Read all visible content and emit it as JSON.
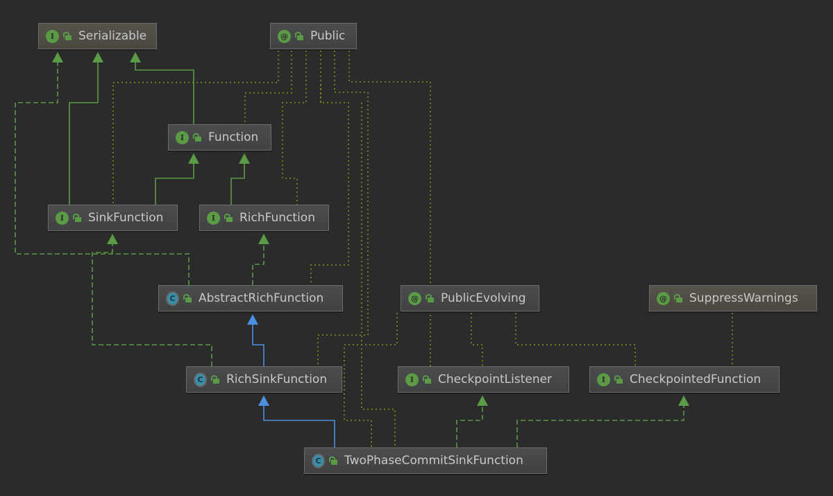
{
  "diagram": {
    "nodes": [
      {
        "id": "serializable",
        "label": "Serializable",
        "kind": "interface",
        "badge": "I"
      },
      {
        "id": "public",
        "label": "Public",
        "kind": "annotation",
        "badge": "@"
      },
      {
        "id": "function",
        "label": "Function",
        "kind": "interface",
        "badge": "I"
      },
      {
        "id": "sinkfunction",
        "label": "SinkFunction",
        "kind": "interface",
        "badge": "I"
      },
      {
        "id": "richfunction",
        "label": "RichFunction",
        "kind": "interface",
        "badge": "I"
      },
      {
        "id": "abstractrichfunction",
        "label": "AbstractRichFunction",
        "kind": "abstract-class",
        "badge": "C"
      },
      {
        "id": "publicevolving",
        "label": "PublicEvolving",
        "kind": "annotation",
        "badge": "@"
      },
      {
        "id": "suppresswarnings",
        "label": "SuppressWarnings",
        "kind": "annotation",
        "badge": "@"
      },
      {
        "id": "richsinkfunction",
        "label": "RichSinkFunction",
        "kind": "abstract-class",
        "badge": "C"
      },
      {
        "id": "checkpointlistener",
        "label": "CheckpointListener",
        "kind": "interface",
        "badge": "I"
      },
      {
        "id": "checkpointedfunction",
        "label": "CheckpointedFunction",
        "kind": "interface",
        "badge": "I"
      },
      {
        "id": "twophasecommitsinkfunction",
        "label": "TwoPhaseCommitSinkFunction",
        "kind": "abstract-class",
        "badge": "C"
      }
    ],
    "edges": [
      {
        "from": "function",
        "to": "serializable",
        "type": "extends-interface"
      },
      {
        "from": "sinkfunction",
        "to": "serializable",
        "type": "extends-interface"
      },
      {
        "from": "sinkfunction",
        "to": "function",
        "type": "extends-interface"
      },
      {
        "from": "richfunction",
        "to": "function",
        "type": "extends-interface"
      },
      {
        "from": "abstractrichfunction",
        "to": "serializable",
        "type": "implements"
      },
      {
        "from": "abstractrichfunction",
        "to": "richfunction",
        "type": "implements"
      },
      {
        "from": "richsinkfunction",
        "to": "sinkfunction",
        "type": "implements"
      },
      {
        "from": "richsinkfunction",
        "to": "abstractrichfunction",
        "type": "extends-class"
      },
      {
        "from": "twophasecommitsinkfunction",
        "to": "richsinkfunction",
        "type": "extends-class"
      },
      {
        "from": "twophasecommitsinkfunction",
        "to": "checkpointlistener",
        "type": "implements"
      },
      {
        "from": "twophasecommitsinkfunction",
        "to": "checkpointedfunction",
        "type": "implements"
      },
      {
        "from": "public",
        "to": "sinkfunction",
        "type": "annotates"
      },
      {
        "from": "public",
        "to": "function",
        "type": "annotates"
      },
      {
        "from": "public",
        "to": "richfunction",
        "type": "annotates"
      },
      {
        "from": "public",
        "to": "abstractrichfunction",
        "type": "annotates"
      },
      {
        "from": "public",
        "to": "richsinkfunction",
        "type": "annotates"
      },
      {
        "from": "public",
        "to": "checkpointlistener",
        "type": "annotates"
      },
      {
        "from": "public",
        "to": "twophasecommitsinkfunction",
        "type": "annotates"
      },
      {
        "from": "publicevolving",
        "to": "twophasecommitsinkfunction",
        "type": "annotates"
      },
      {
        "from": "publicevolving",
        "to": "checkpointedfunction",
        "type": "annotates"
      },
      {
        "from": "suppresswarnings",
        "to": "checkpointedfunction",
        "type": "annotates"
      }
    ],
    "colors": {
      "background": "#2b2b2b",
      "interface_edge": "#5b9b46",
      "class_edge": "#4a90e2",
      "annotation_edge": "#8c8c1a",
      "interface_badge": "#5b9b46",
      "class_badge": "#3a8da6"
    }
  }
}
